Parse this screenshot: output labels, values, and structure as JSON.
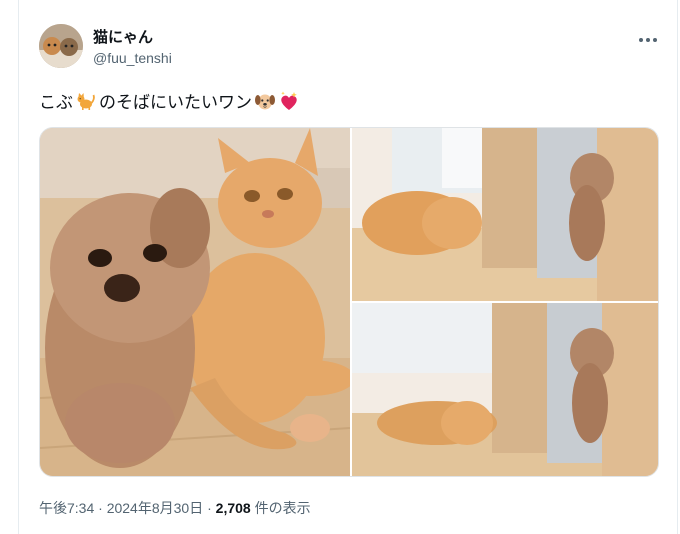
{
  "author": {
    "display_name": "猫にゃん",
    "handle": "@fuu_tenshi"
  },
  "tweet": {
    "text_before": "こぶ",
    "text_mid": "のそばにいたいワン",
    "emojis": [
      "cat-emoji",
      "dog-face-emoji",
      "sparkling-heart-emoji"
    ]
  },
  "media": {
    "photos": [
      {
        "name": "photo-dog-and-cat-closeup",
        "icon": "photo"
      },
      {
        "name": "photo-cat-hallway-dog-behind-door",
        "icon": "photo"
      },
      {
        "name": "photo-cat-lying-dog-behind-door",
        "icon": "photo"
      }
    ]
  },
  "meta": {
    "time": "午後7:34",
    "separator": "·",
    "date": "2024年8月30日",
    "views_count": "2,708",
    "views_label": "件の表示"
  },
  "colors": {
    "text": "#0f1419",
    "secondary": "#536471",
    "heart": "#e0245e"
  }
}
